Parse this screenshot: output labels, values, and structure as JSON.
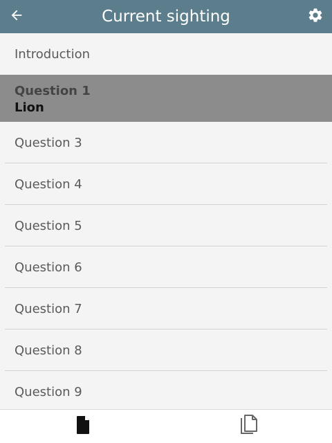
{
  "header": {
    "title": "Current sighting",
    "back_icon": "arrow-left-icon",
    "settings_icon": "gear-icon"
  },
  "list": {
    "intro_label": "Introduction",
    "selected": {
      "question": "Question 1",
      "answer": "Lion"
    },
    "items": [
      {
        "label": "Question 3"
      },
      {
        "label": "Question 4"
      },
      {
        "label": "Question 5"
      },
      {
        "label": "Question 6"
      },
      {
        "label": "Question 7"
      },
      {
        "label": "Question 8"
      },
      {
        "label": "Question 9"
      }
    ]
  },
  "footer": {
    "left_icon": "document-icon",
    "right_icon": "copy-icon"
  },
  "colors": {
    "header_bg": "#5c7e8c",
    "selected_bg": "#8c8c8c",
    "list_bg": "#f4f4f4"
  }
}
